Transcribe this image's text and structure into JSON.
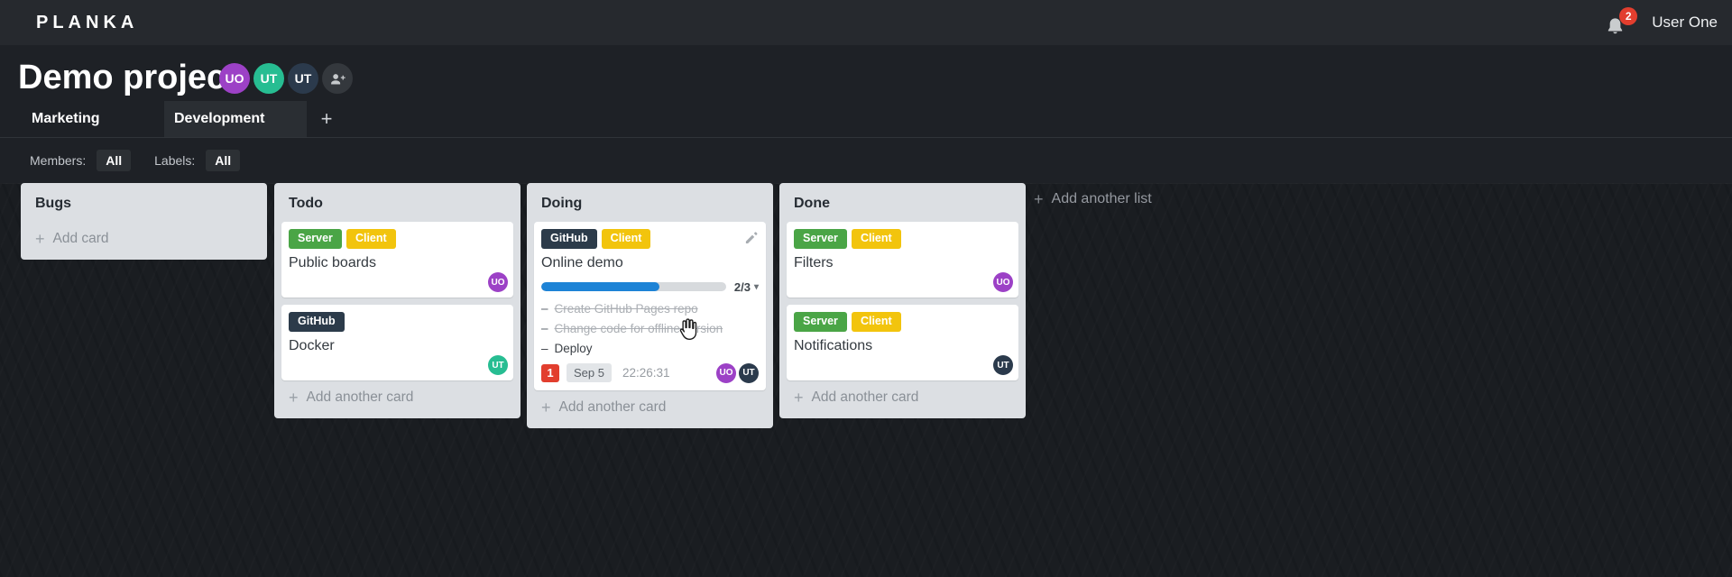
{
  "glyphs": {
    "plus": "+",
    "caret_down": "▾",
    "dash": "–"
  },
  "topbar": {
    "logo": "PLANKA",
    "notifications_count": "2",
    "user_name": "User One"
  },
  "project": {
    "title": "Demo project",
    "members": [
      {
        "initials": "UO"
      },
      {
        "initials": "UT"
      },
      {
        "initials": "UT"
      }
    ]
  },
  "tabs": {
    "items": [
      {
        "label": "Marketing",
        "active": false
      },
      {
        "label": "Development",
        "active": true
      }
    ]
  },
  "filters": {
    "members_label": "Members:",
    "members_value": "All",
    "labels_label": "Labels:",
    "labels_value": "All"
  },
  "board": {
    "add_list_label": "Add another list",
    "lists": [
      {
        "name": "Bugs",
        "add_card_label": "Add card",
        "cards": []
      },
      {
        "name": "Todo",
        "add_card_label": "Add another card",
        "cards": [
          {
            "title": "Public boards",
            "labels": [
              "Server",
              "Client"
            ],
            "member": "UO"
          },
          {
            "title": "Docker",
            "labels": [
              "GitHub"
            ],
            "member": "UT"
          }
        ]
      },
      {
        "name": "Doing",
        "add_card_label": "Add another card",
        "cards": [
          {
            "title": "Online demo",
            "labels": [
              "GitHub",
              "Client"
            ],
            "progress": {
              "completed": 2,
              "total": 3,
              "display": "2/3",
              "percent": 64
            },
            "tasks": [
              {
                "text": "Create GitHub Pages repo",
                "done": true
              },
              {
                "text": "Change code for offline version",
                "done": true
              },
              {
                "text": "Deploy",
                "done": false
              }
            ],
            "notification_count": "1",
            "due_date": "Sep 5",
            "stopwatch": "22:26:31",
            "members": [
              "UO",
              "UT"
            ]
          }
        ]
      },
      {
        "name": "Done",
        "add_card_label": "Add another card",
        "cards": [
          {
            "title": "Filters",
            "labels": [
              "Server",
              "Client"
            ],
            "member": "UO"
          },
          {
            "title": "Notifications",
            "labels": [
              "Server",
              "Client"
            ],
            "member": "UT"
          }
        ]
      }
    ]
  },
  "colors": {
    "topbar_bg": "#26292e",
    "page_bg": "#1e2126",
    "board_bg": "#1a1d21",
    "list_bg": "#dcdfe3",
    "card_bg": "#ffffff",
    "label_server": "#4aa546",
    "label_client": "#f2c40d",
    "label_github": "#2c3b4a",
    "avatar_purple": "#9c41c6",
    "avatar_teal": "#27bd92",
    "avatar_navy": "#2b3a4c",
    "badge_red": "#e23e2e",
    "progress_blue": "#1d83d6",
    "due_badge_bg": "#e2e5e8"
  }
}
